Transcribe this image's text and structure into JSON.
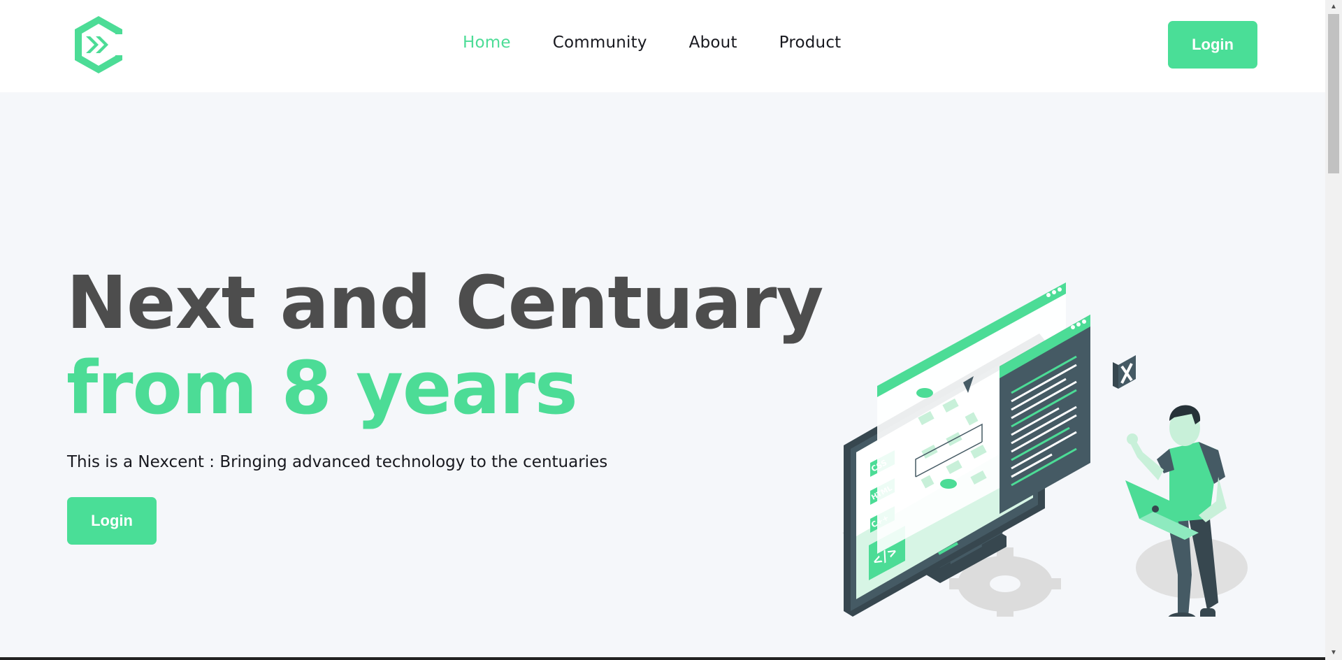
{
  "header": {
    "nav": [
      {
        "label": "Home",
        "active": true
      },
      {
        "label": "Community",
        "active": false
      },
      {
        "label": "About",
        "active": false
      },
      {
        "label": "Product",
        "active": false
      }
    ],
    "login_label": "Login"
  },
  "hero": {
    "title_line1": "Next and Centuary",
    "title_line2": "from 8 years",
    "subtitle": "This is a Nexcent : Bringing advanced technology to the centuaries",
    "login_label": "Login",
    "illustration_labels": [
      "CSS",
      "HTML",
      "C++",
      "</>"
    ]
  },
  "colors": {
    "accent": "#4cdc96",
    "button": "#4ade97",
    "heading": "#4d4d4d",
    "background": "#f5f7fa",
    "dark": "#455a64"
  },
  "icons": {
    "logo": "nexcent-logo-icon",
    "scroll_up": "scroll-up-arrow-icon",
    "scroll_down": "scroll-down-arrow-icon"
  }
}
